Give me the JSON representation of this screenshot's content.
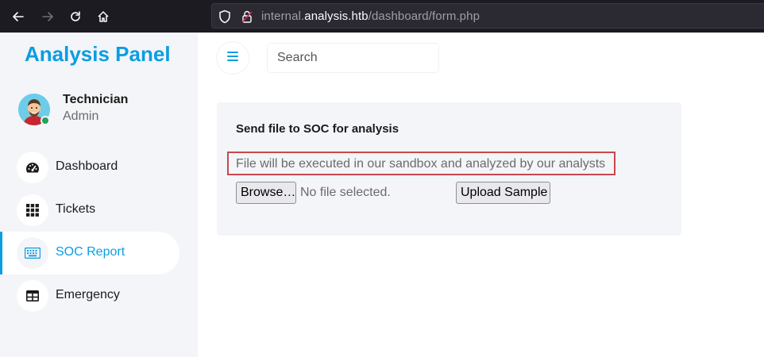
{
  "browser": {
    "url_prefix": "internal.",
    "url_domain": "analysis.htb",
    "url_path": "/dashboard/form.php"
  },
  "sidebar": {
    "brand": "Analysis Panel",
    "user": {
      "name": "Technician",
      "role": "Admin"
    },
    "items": [
      {
        "label": "Dashboard",
        "icon": "gauge-icon",
        "active": false
      },
      {
        "label": "Tickets",
        "icon": "grid-icon",
        "active": false
      },
      {
        "label": "SOC Report",
        "icon": "keyboard-icon",
        "active": true
      },
      {
        "label": "Emergency",
        "icon": "table-icon",
        "active": false
      }
    ]
  },
  "header": {
    "search_placeholder": "Search"
  },
  "main": {
    "card_title": "Send file to SOC for analysis",
    "card_description": "File will be executed in our sandbox and analyzed by our analysts",
    "browse_label": "Browse…",
    "file_status": "No file selected.",
    "upload_label": "Upload Sample"
  },
  "colors": {
    "accent": "#0b9de2",
    "highlight_border": "#c9474f",
    "sidebar_bg": "#f3f5f8",
    "browser_chrome": "#1c1b22",
    "online_status": "#21a35a"
  }
}
